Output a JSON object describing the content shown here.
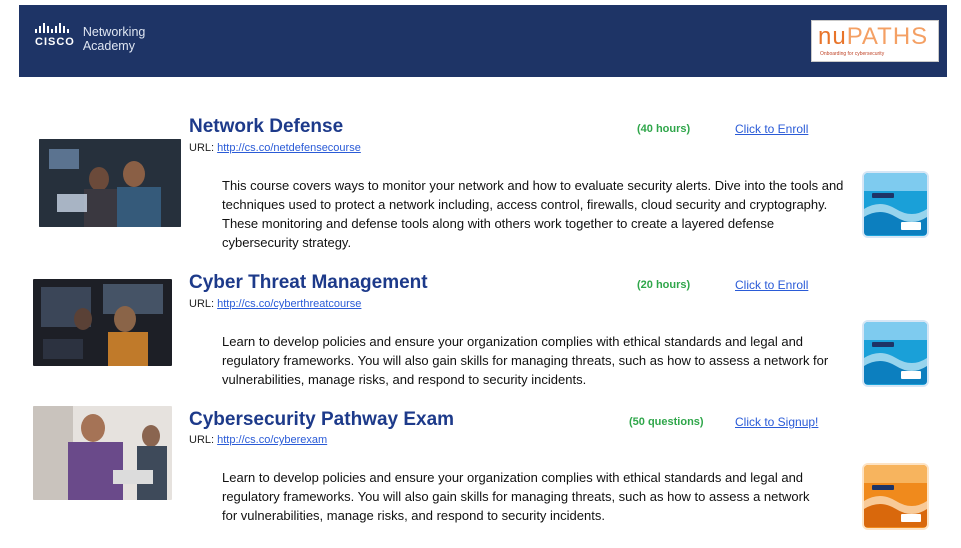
{
  "header": {
    "cisco_word": "CISCO",
    "academy_line1": "Networking",
    "academy_line2": "Academy",
    "partner_logo_nu": "nu",
    "partner_logo_paths": "PATHS",
    "partner_tagline": "Onboarding for cybersecurity"
  },
  "courses": [
    {
      "title": "Network Defense",
      "url_label": "URL:",
      "url": "http://cs.co/netdefensecourse",
      "meta": "(40 hours)",
      "action": "Click to Enroll",
      "description": "This course covers ways to monitor your network and how to evaluate security alerts. Dive into the tools and techniques used to protect a network including, access control, firewalls, cloud security and cryptography. These monitoring and defense tools along with others work together to create a layered defense cybersecurity strategy.",
      "badge_color": "#1aa0d8"
    },
    {
      "title": "Cyber Threat Management",
      "url_label": "URL:",
      "url": "http://cs.co/cyberthreatcourse",
      "meta": "(20 hours)",
      "action": "Click to Enroll",
      "description": "Learn to develop policies and ensure your organization complies with ethical standards and legal and regulatory frameworks.  You will also gain skills for managing threats, such as how to assess a network for vulnerabilities, manage risks, and respond to security incidents.",
      "badge_color": "#1aa0d8"
    },
    {
      "title": "Cybersecurity Pathway Exam",
      "url_label": "URL:",
      "url": "http://cs.co/cyberexam",
      "meta": "(50 questions)",
      "action": "Click to Signup!",
      "description": "Learn to develop policies and ensure your organization complies with ethical standards and legal and regulatory frameworks.  You will also gain skills for managing threats, such as how to assess a network for vulnerabilities, manage risks, and respond to security incidents.",
      "badge_color": "#f08a1c"
    }
  ]
}
